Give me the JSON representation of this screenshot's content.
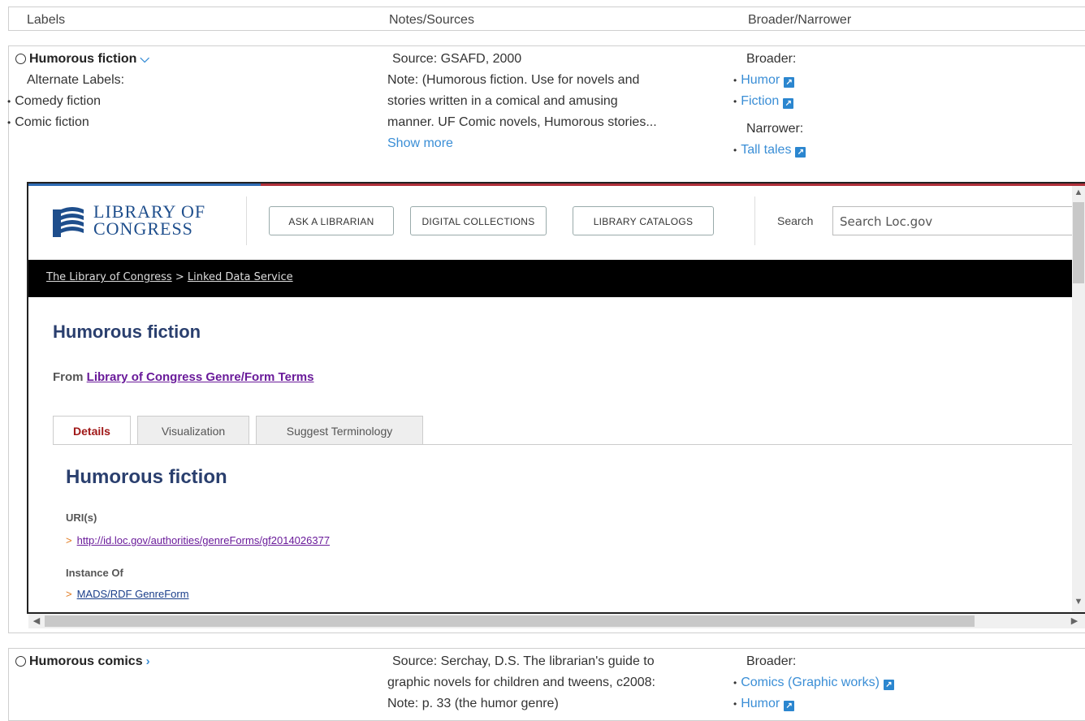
{
  "headers": {
    "labels": "Labels",
    "notes": "Notes/Sources",
    "broader": "Broader/Narrower"
  },
  "entry1": {
    "term": "Humorous fiction",
    "alt_heading": "Alternate Labels:",
    "alternates": [
      "Comedy fiction",
      "Comic fiction"
    ],
    "source": "Source: GSAFD, 2000",
    "note_lines": [
      "Note: (Humorous fiction. Use for novels and",
      "stories written in a comical and amusing",
      "manner. UF Comic novels, Humorous stories..."
    ],
    "show_more": "Show more",
    "broader_heading": "Broader:",
    "broader": [
      "Humor",
      "Fiction"
    ],
    "narrower_heading": "Narrower:",
    "narrower": [
      "Tall tales"
    ]
  },
  "loc": {
    "logo_line1": "LIBRARY OF",
    "logo_line2": "CONGRESS",
    "nav": [
      "ASK A LIBRARIAN",
      "DIGITAL COLLECTIONS",
      "LIBRARY CATALOGS"
    ],
    "search_label": "Search",
    "search_placeholder": "Search Loc.gov",
    "crumb1": "The Library of Congress",
    "crumb_sep": ">",
    "crumb2": "Linked Data Service",
    "title": "Humorous fiction",
    "from_label": "From",
    "from_link": "Library of Congress Genre/Form Terms",
    "tabs": [
      "Details",
      "Visualization",
      "Suggest Terminology"
    ],
    "section_title": "Humorous fiction",
    "uri_label": "URI(s)",
    "uri": "http://id.loc.gov/authorities/genreForms/gf2014026377",
    "instance_label": "Instance Of",
    "instance": "MADS/RDF GenreForm"
  },
  "entry2": {
    "term": "Humorous comics",
    "source_lines": [
      "Source: Serchay, D.S. The librarian's guide to",
      "graphic novels for children and tweens, c2008:",
      "Note: p. 33 (the humor genre)"
    ],
    "broader_heading": "Broader:",
    "broader": [
      "Comics (Graphic works)",
      "Humor"
    ]
  },
  "colors": {
    "link": "#3a8ed6",
    "loc_title": "#2a3f6e",
    "tab_active": "#a01818",
    "visited": "#6a1b9a"
  }
}
